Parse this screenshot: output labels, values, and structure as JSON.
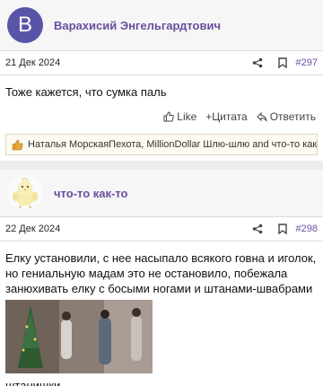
{
  "posts": [
    {
      "author": "Варахисий Энгельгардтович",
      "avatar_letter": "В",
      "date": "21 Дек 2024",
      "number": "#297",
      "text": "Тоже кажется, что сумка паль",
      "actions": {
        "like": "Like",
        "quote": "+Цитата",
        "reply": "Ответить"
      },
      "likes_text": "Наталья МорскаяПехота, MillionDollar Шлю-шлю and что-то как-то"
    },
    {
      "author": "что-то как-то",
      "avatar_icon": "chick-avatar",
      "date": "22 Дек 2024",
      "number": "#298",
      "text": "Елку установили, с нее насыпало всякого говна и иголок, но гениальную мадам это не остановило, побежала занюхивать елку с босыми ногами и штанами-швабрами",
      "caption": "штанишки"
    }
  ],
  "icons": {
    "share": "share-icon",
    "bookmark": "bookmark-icon",
    "like": "thumb-up-icon",
    "reply": "reply-icon"
  },
  "colors": {
    "accent": "#6b4e9e",
    "avatar_bg": "#5a54a8",
    "likes_bg": "#fcfaf1"
  }
}
